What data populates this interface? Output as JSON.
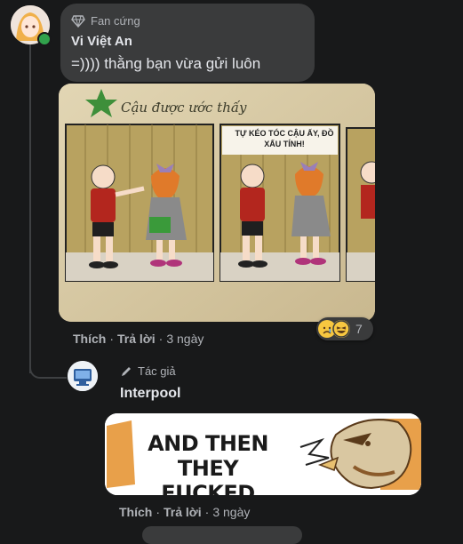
{
  "comment1": {
    "badge": "Fan cứng",
    "author": "Vi Việt An",
    "text": "=)))) thằng bạn vừa gửi luôn",
    "image_caption": "Cậu được ước thấy",
    "image_speech": "TỰ KÉO TÓC CẬU ẤY, ĐỒ XẤU TÍNH!",
    "actions": {
      "like": "Thích",
      "reply": "Trả lời",
      "time": "3 ngày"
    },
    "reactions": {
      "count": "7",
      "icons": [
        "sad-react",
        "haha-react"
      ]
    }
  },
  "reply1": {
    "badge": "Tác giả",
    "author": "Interpool",
    "image_text": "AND THEN THEY FUCKED",
    "actions": {
      "like": "Thích",
      "reply": "Trả lời",
      "time": "3 ngày"
    }
  },
  "colors": {
    "background": "#18191a",
    "bubble": "#3a3b3c",
    "text": "#e4e6eb",
    "muted": "#b0b3b8",
    "online": "#31a24c"
  }
}
